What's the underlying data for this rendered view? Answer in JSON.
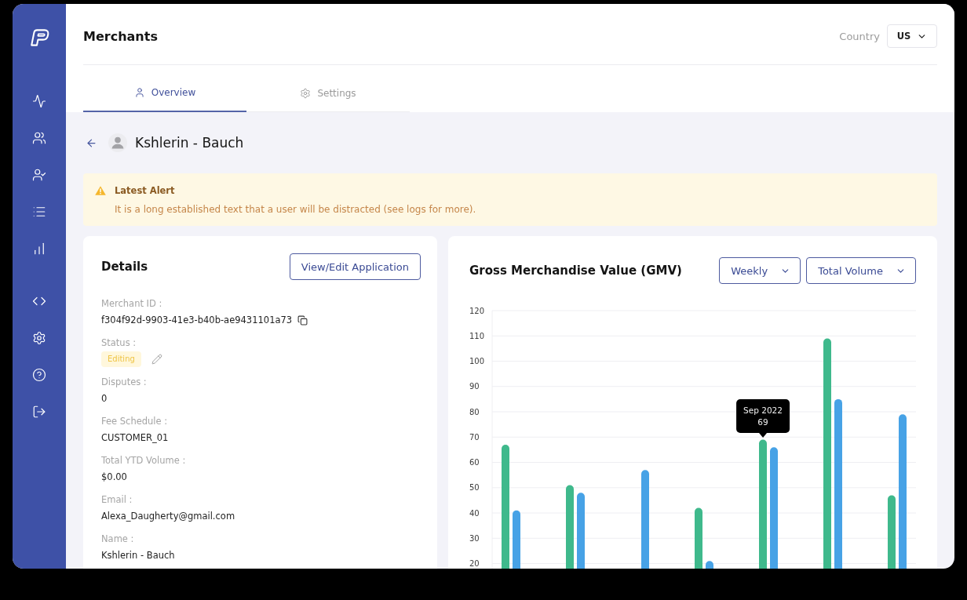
{
  "header": {
    "title": "Merchants",
    "country": {
      "label": "Country",
      "value": "US"
    }
  },
  "tabs": [
    {
      "label": "Overview",
      "selected": true
    },
    {
      "label": "Settings",
      "selected": false
    }
  ],
  "merchant": {
    "name": "Kshlerin - Bauch"
  },
  "alert": {
    "title": "Latest Alert",
    "message": "It is a long established text that a user will be distracted (see logs for more)."
  },
  "details": {
    "title": "Details",
    "button": "View/Edit Application",
    "fields": [
      {
        "kind": "copy",
        "label": "Merchant ID :",
        "value": "f304f92d-9903-41e3-b40b-ae9431101a73"
      },
      {
        "kind": "badge",
        "label": "Status :",
        "value": "Editing"
      },
      {
        "kind": "text",
        "label": "Disputes :",
        "value": "0"
      },
      {
        "kind": "text",
        "label": "Fee Schedule :",
        "value": "CUSTOMER_01"
      },
      {
        "kind": "text",
        "label": "Total YTD Volume :",
        "value": "$0.00"
      },
      {
        "kind": "text",
        "label": "Email :",
        "value": "Alexa_Daugherty@gmail.com"
      },
      {
        "kind": "text",
        "label": "Name :",
        "value": "Kshlerin - Bauch"
      }
    ]
  },
  "gmv": {
    "title": "Gross Merchandise Value (GMV)",
    "filters": [
      "Weekly",
      "Total Volume"
    ],
    "chart_data": {
      "type": "bar",
      "grid": true,
      "ylim": [
        18,
        120
      ],
      "yticks": [
        20,
        30,
        40,
        50,
        60,
        70,
        80,
        90,
        100,
        110,
        120
      ],
      "series": [
        {
          "color": "#3fb98c",
          "values": [
            67,
            51,
            null,
            42,
            69,
            109,
            47
          ]
        },
        {
          "color": "#47a2e6",
          "values": [
            41,
            48,
            57,
            21,
            66,
            85,
            79
          ]
        }
      ],
      "annotations": [
        {
          "y": 69,
          "text": "Sep 2022\n69"
        }
      ]
    }
  }
}
